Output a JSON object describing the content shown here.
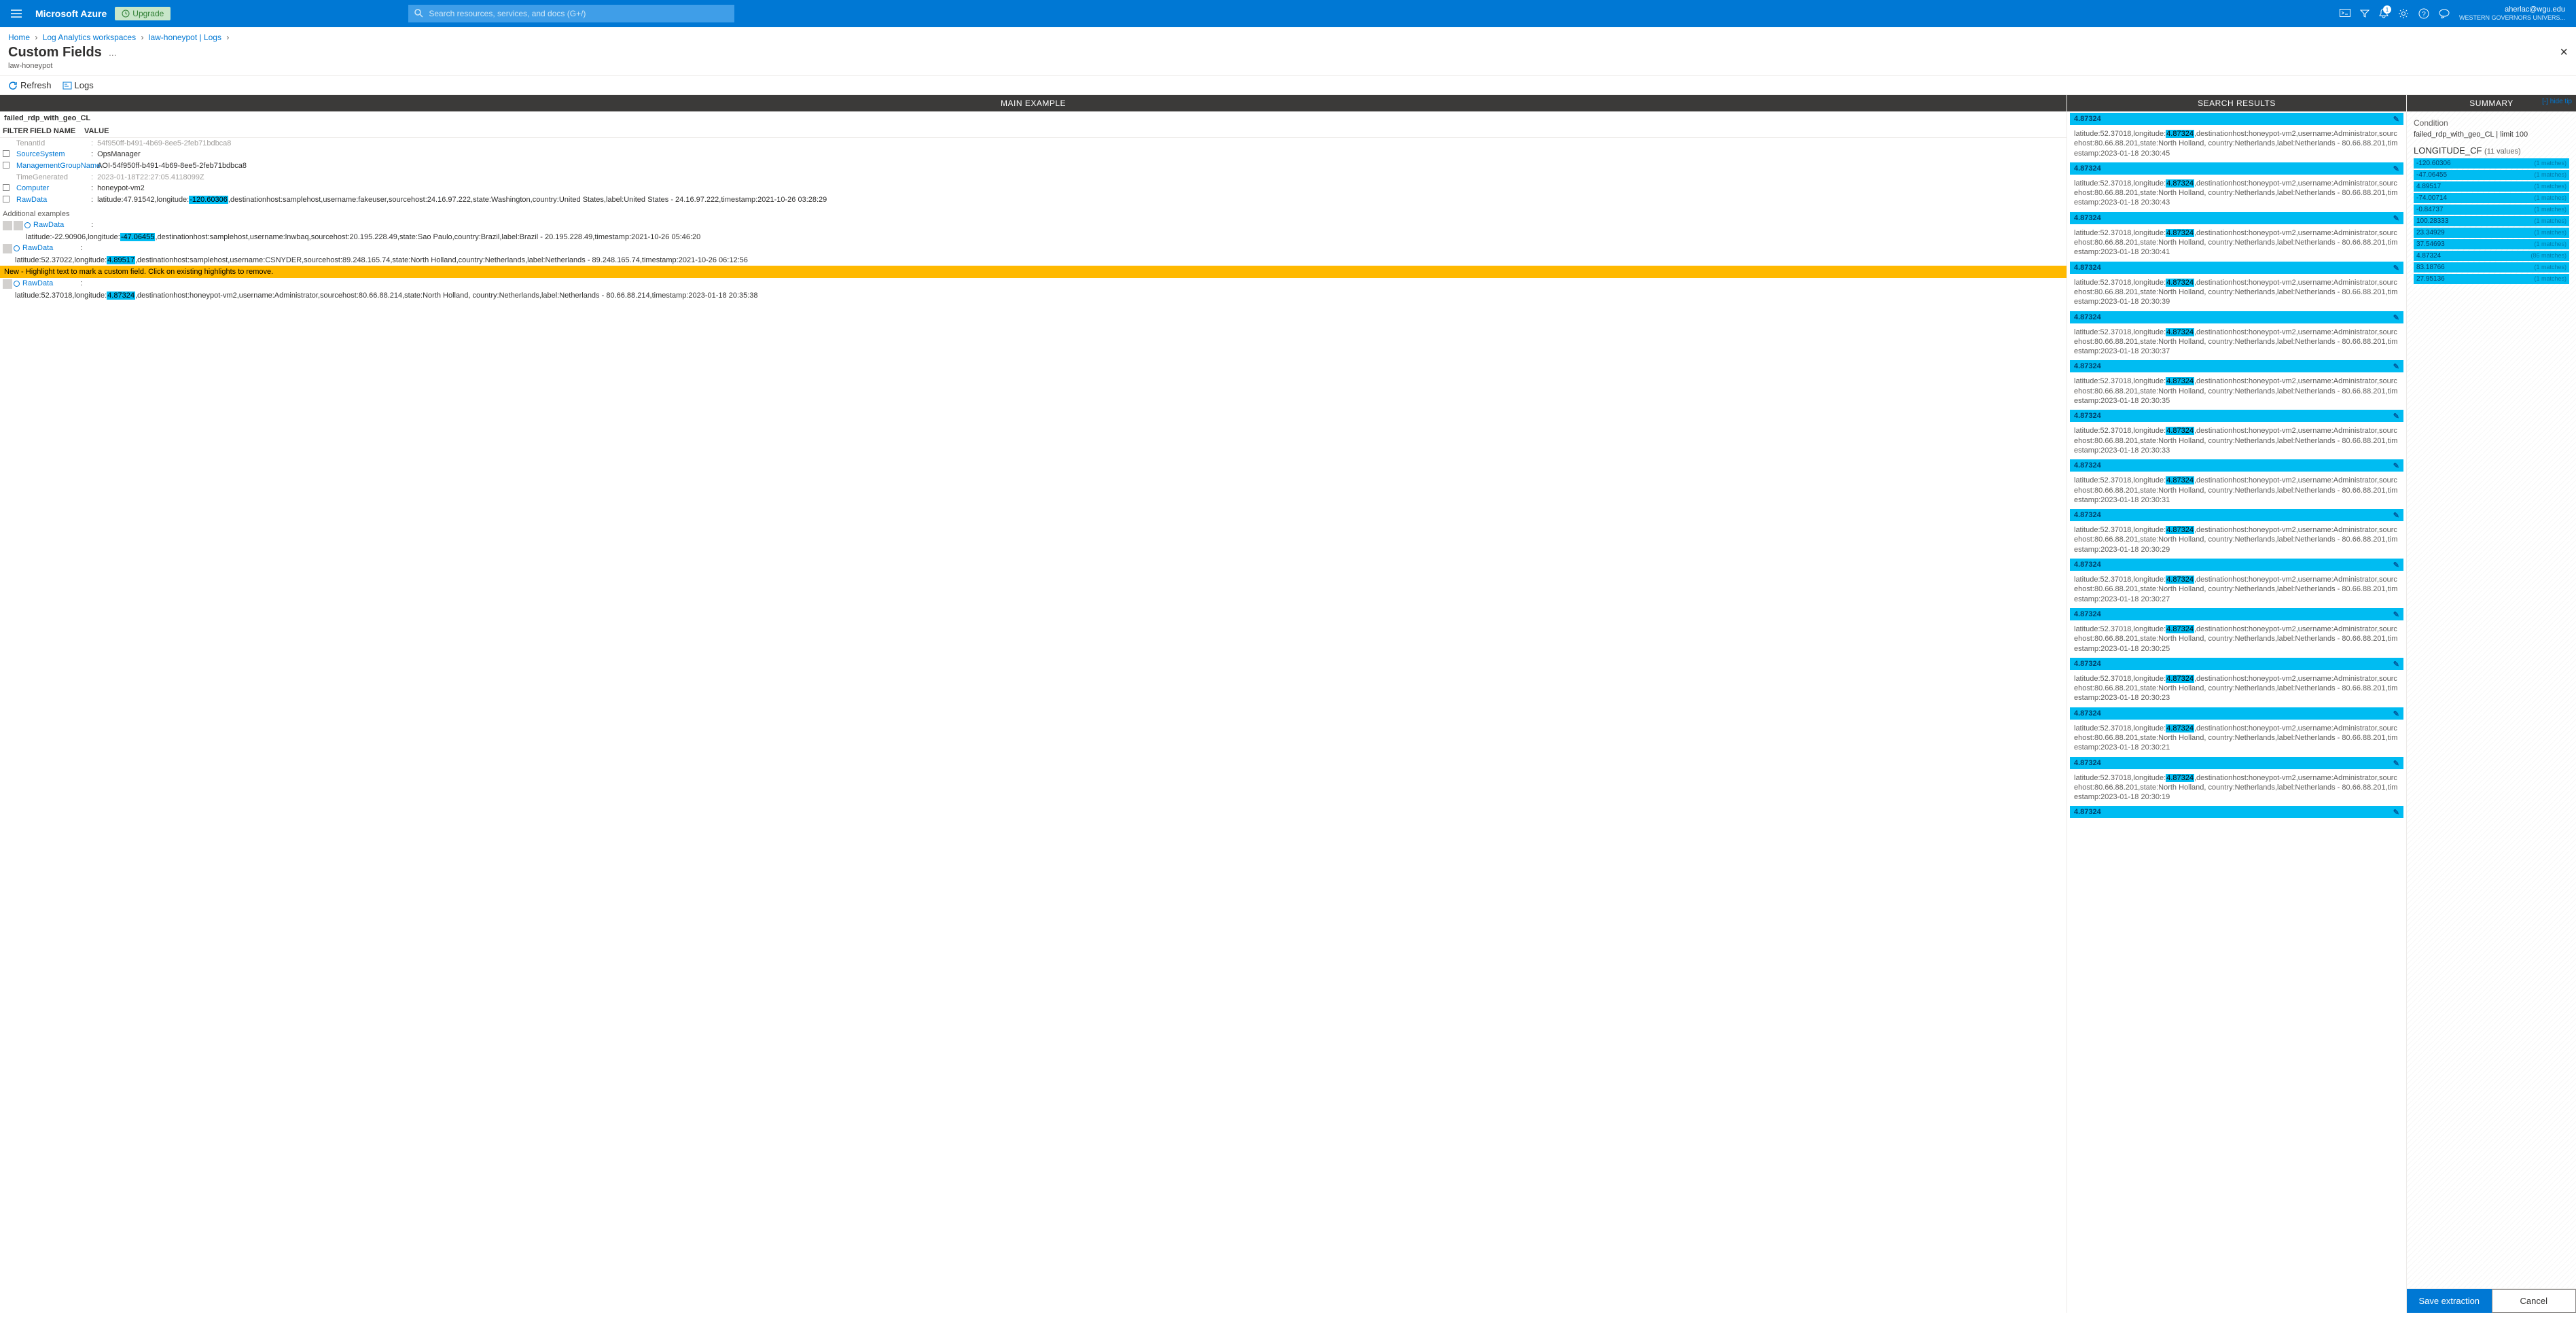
{
  "top": {
    "brand": "Microsoft Azure",
    "upgrade": "Upgrade",
    "search_placeholder": "Search resources, services, and docs (G+/)",
    "user_email": "aherlac@wgu.edu",
    "user_org": "WESTERN GOVERNORS UNIVERS...",
    "bell_count": "1"
  },
  "breadcrumb": {
    "items": [
      "Home",
      "Log Analytics workspaces",
      "law-honeypot | Logs"
    ]
  },
  "page": {
    "title": "Custom Fields",
    "subtitle": "law-honeypot",
    "refresh": "Refresh",
    "logs": "Logs"
  },
  "cols": {
    "main": "MAIN EXAMPLE",
    "results": "SEARCH RESULTS",
    "summary": "SUMMARY"
  },
  "main_example": {
    "table_name": "failed_rdp_with_geo_CL",
    "headers": {
      "filter": "FILTER",
      "field": "FIELD NAME",
      "value": "VALUE"
    },
    "rows": [
      {
        "field": "TenantId",
        "link": false,
        "value": "54f950ff-b491-4b69-8ee5-2feb71bdbca8"
      },
      {
        "field": "SourceSystem",
        "link": true,
        "value": "OpsManager"
      },
      {
        "field": "ManagementGroupName",
        "link": true,
        "value": "AOI-54f950ff-b491-4b69-8ee5-2feb71bdbca8"
      },
      {
        "field": "TimeGenerated",
        "link": false,
        "value": "2023-01-18T22:27:05.4118099Z"
      },
      {
        "field": "Computer",
        "link": true,
        "value": "honeypot-vm2"
      },
      {
        "field": "RawData",
        "link": true,
        "prefix": "latitude:47.91542,longitude:",
        "highlight": "-120.60306",
        "suffix": ",destinationhost:samplehost,username:fakeuser,sourcehost:24.16.97.222,state:Washington,country:United States,label:United States - 24.16.97.222,timestamp:2021-10-26 03:28:29"
      }
    ],
    "additional_label": "Additional examples",
    "addex": [
      {
        "prefix": "latitude:-22.90906,longitude:",
        "highlight": "-47.06455",
        "suffix": ",destinationhost:samplehost,username:lnwbaq,sourcehost:20.195.228.49,state:Sao Paulo,country:Brazil,label:Brazil - 20.195.228.49,timestamp:2021-10-26 05:46:20"
      },
      {
        "prefix": "latitude:52.37022,longitude:",
        "highlight": "4.89517",
        "suffix": ",destinationhost:samplehost,username:CSNYDER,sourcehost:89.248.165.74,state:North Holland,country:Netherlands,label:Netherlands - 89.248.165.74,timestamp:2021-10-26 06:12:56"
      },
      {
        "prefix": "latitude:52.37018,longitude:",
        "highlight": "4.87324",
        "suffix": ",destinationhost:honeypot-vm2,username:Administrator,sourcehost:80.66.88.214,state:North Holland, country:Netherlands,label:Netherlands - 80.66.88.214,timestamp:2023-01-18 20:35:38"
      }
    ],
    "rawdata_label": "RawData",
    "yellow": "New - Highlight text to mark a custom field. Click on existing highlights to remove."
  },
  "search_results": {
    "header_value": "4.87324",
    "highlight": "4.87324",
    "prefix": "latitude:52.37018,longitude:",
    "mid": ",destinationhost:honeypot-vm2,username:Administrator,sourcehost:80.66.88.201,state:North Holland, country:Netherlands,label:Netherlands - 80.66.88.201,timestamp:2023-01-18 ",
    "times": [
      "20:30:45",
      "20:30:43",
      "20:30:41",
      "20:30:39",
      "20:30:37",
      "20:30:35",
      "20:30:33",
      "20:30:31",
      "20:30:29",
      "20:30:27",
      "20:30:25",
      "20:30:23",
      "20:30:21",
      "20:30:19"
    ]
  },
  "summary": {
    "hide": "[-] hide tip",
    "condition_label": "Condition",
    "condition_value": "failed_rdp_with_geo_CL | limit 100",
    "group_name": "LONGITUDE_CF",
    "group_count": "(11 values)",
    "bars": [
      {
        "v": "-120.60306",
        "m": "(1 matches)"
      },
      {
        "v": "-47.06455",
        "m": "(1 matches)"
      },
      {
        "v": "4.89517",
        "m": "(1 matches)"
      },
      {
        "v": "-74.00714",
        "m": "(1 matches)"
      },
      {
        "v": "-0.84737",
        "m": "(1 matches)"
      },
      {
        "v": "100.28333",
        "m": "(1 matches)"
      },
      {
        "v": "23.34929",
        "m": "(1 matches)"
      },
      {
        "v": "37.54693",
        "m": "(1 matches)"
      },
      {
        "v": "4.87324",
        "m": "(86 matches)"
      },
      {
        "v": "83.18766",
        "m": "(1 matches)"
      },
      {
        "v": "27.95136",
        "m": "(1 matches)"
      }
    ],
    "save": "Save extraction",
    "cancel": "Cancel"
  }
}
